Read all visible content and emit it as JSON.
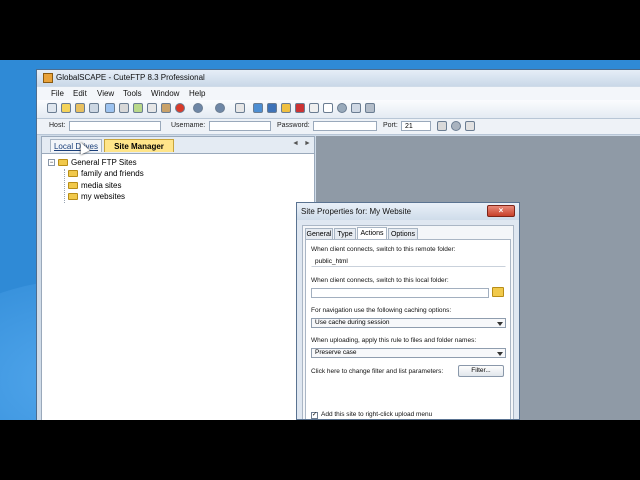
{
  "app": {
    "title": "GlobalSCAPE - CuteFTP 8.3 Professional",
    "menu": [
      "File",
      "Edit",
      "View",
      "Tools",
      "Window",
      "Help"
    ]
  },
  "quick_connect": {
    "host_label": "Host:",
    "username_label": "Username:",
    "password_label": "Password:",
    "port_label": "Port:",
    "port_value": "21"
  },
  "left_pane": {
    "tabs": [
      "Local Drives",
      "Site Manager"
    ],
    "active_tab": "Site Manager",
    "nav_prev": "◄",
    "nav_next": "►",
    "tree": {
      "root": "General FTP Sites",
      "expander": "−",
      "children": [
        "family and friends",
        "media sites",
        "my websites"
      ]
    }
  },
  "dialog": {
    "title": "Site Properties for: My Website",
    "close_glyph": "×",
    "tabs": [
      "General",
      "Type",
      "Actions",
      "Options"
    ],
    "active_tab": "Actions",
    "remote_folder_label": "When client connects, switch to this remote folder:",
    "remote_folder_value": "public_html",
    "local_folder_label": "When client connects, switch to this local folder:",
    "local_folder_value": "",
    "caching_label": "For navigation use the following caching options:",
    "caching_value": "Use cache during session",
    "upload_rule_label": "When uploading, apply this rule to files and folder names:",
    "upload_rule_value": "Preserve case",
    "filter_label": "Click here to change filter and list parameters:",
    "filter_button": "Filter...",
    "upload_menu_label": "Add this site to right-click upload menu",
    "upload_menu_checked": "✓"
  },
  "colors": {
    "desktop": "#2f8ad6",
    "site_manager_tab": "#ffe58a",
    "folder": "#f1c94b",
    "close_button": "#c7402a"
  }
}
